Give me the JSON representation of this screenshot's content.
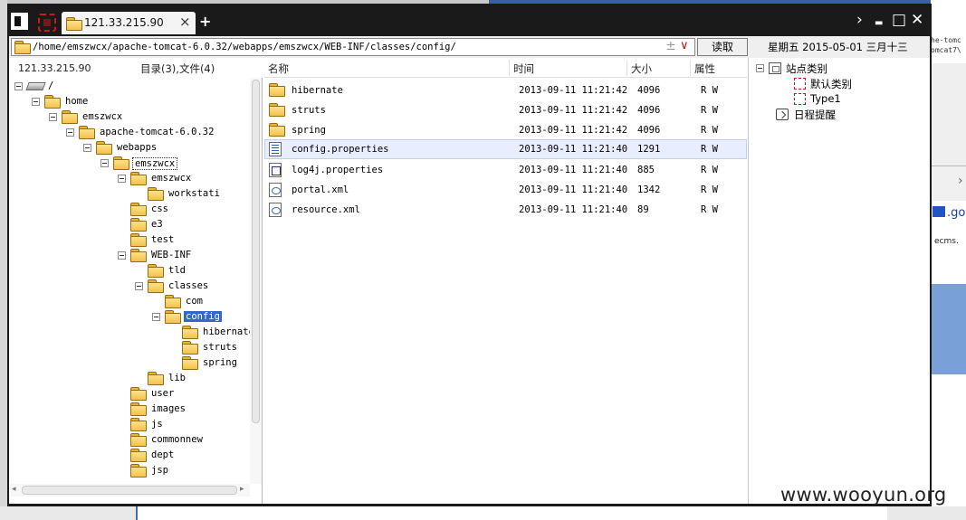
{
  "tab": {
    "title": "121.33.215.90",
    "close": "×",
    "new_tab": "+"
  },
  "window_buttons": {
    "chevron": "›",
    "minimize": "▬",
    "maximize": "□",
    "close": "✕"
  },
  "address": {
    "path": "/home/emszwcx/apache-tomcat-6.0.32/webapps/emszwcx/WEB-INF/classes/config/",
    "plus": "±",
    "dropdown": "∨"
  },
  "read_button": "读取",
  "date_text": "星期五 2015-05-01 三月十三",
  "left_header": {
    "host": "121.33.215.90",
    "counts": "目录(3),文件(4)"
  },
  "tree": [
    {
      "label": "/",
      "icon": "drive-icon"
    },
    {
      "label": "home"
    },
    {
      "label": "emszwcx"
    },
    {
      "label": "apache-tomcat-6.0.32"
    },
    {
      "label": "webapps"
    },
    {
      "label": "emszwcx"
    },
    {
      "label": "emszwcx"
    },
    {
      "label": "workstati"
    },
    {
      "label": "css"
    },
    {
      "label": "e3"
    },
    {
      "label": "test"
    },
    {
      "label": "WEB-INF"
    },
    {
      "label": "tld"
    },
    {
      "label": "classes"
    },
    {
      "label": "com"
    },
    {
      "label": "config"
    },
    {
      "label": "hibernate"
    },
    {
      "label": "struts"
    },
    {
      "label": "spring"
    },
    {
      "label": "lib"
    },
    {
      "label": "user"
    },
    {
      "label": "images"
    },
    {
      "label": "js"
    },
    {
      "label": "commonnew"
    },
    {
      "label": "dept"
    },
    {
      "label": "jsp"
    }
  ],
  "file_columns": {
    "name": "名称",
    "time": "时间",
    "size": "大小",
    "attr": "属性"
  },
  "files": [
    {
      "name": "hibernate",
      "time": "2013-09-11 11:21:42",
      "size": "4096",
      "attr": "R W",
      "icon": "folder-icon"
    },
    {
      "name": "struts",
      "time": "2013-09-11 11:21:42",
      "size": "4096",
      "attr": "R W",
      "icon": "folder-icon"
    },
    {
      "name": "spring",
      "time": "2013-09-11 11:21:42",
      "size": "4096",
      "attr": "R W",
      "icon": "folder-icon"
    },
    {
      "name": "config.properties",
      "time": "2013-09-11 11:21:40",
      "size": "1291",
      "attr": "R W",
      "icon": "properties-file-icon"
    },
    {
      "name": "log4j.properties",
      "time": "2013-09-11 11:21:40",
      "size": "885",
      "attr": "R W",
      "icon": "log-file-icon"
    },
    {
      "name": "portal.xml",
      "time": "2013-09-11 11:21:40",
      "size": "1342",
      "attr": "R W",
      "icon": "xml-file-icon"
    },
    {
      "name": "resource.xml",
      "time": "2013-09-11 11:21:40",
      "size": "89",
      "attr": "R W",
      "icon": "xml-file-icon"
    }
  ],
  "right_tree": {
    "site_category": "站点类别",
    "default_category": "默认类别",
    "type1": "Type1",
    "schedule": "日程提醒"
  },
  "background": {
    "right_text_1": "he-tomc",
    "right_text_2": "omcat7\\",
    "go_text": ".go",
    "ecms_text": "ecms."
  },
  "watermark": "www.wooyun.org"
}
